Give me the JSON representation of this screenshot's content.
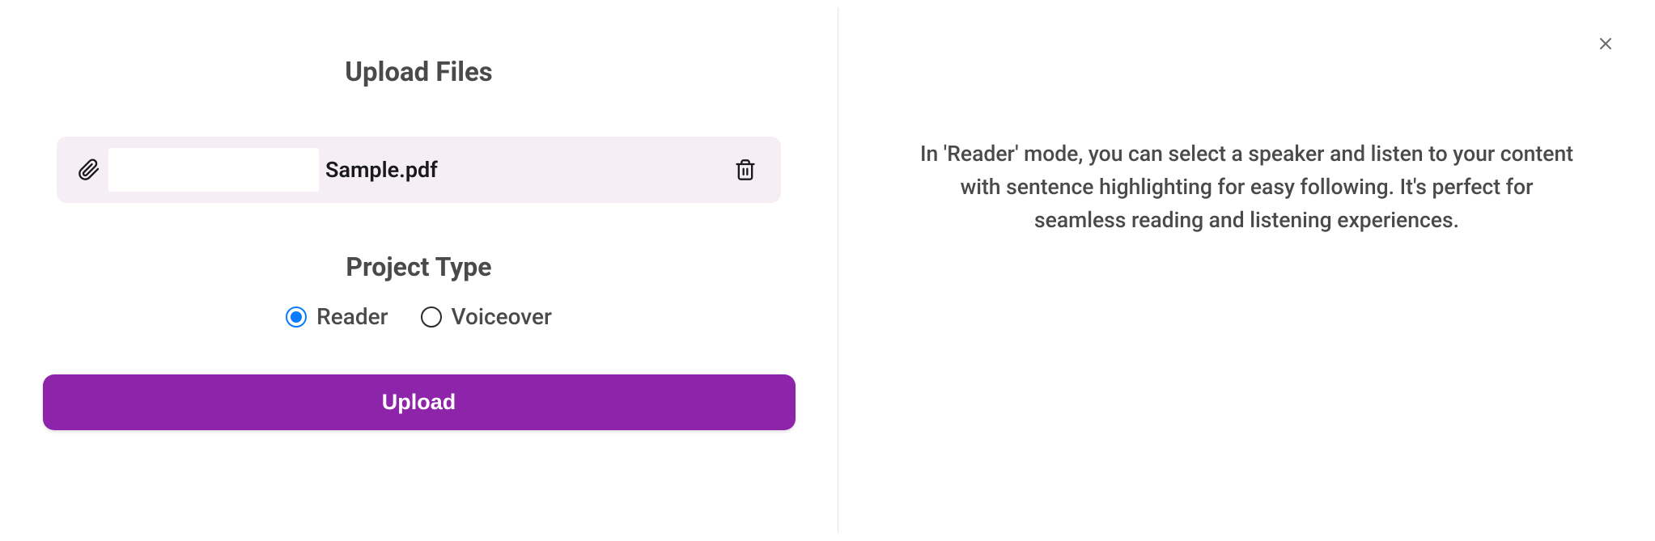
{
  "main": {
    "title": "Upload Files",
    "file": {
      "name": "Sample.pdf"
    },
    "project_type": {
      "label": "Project Type",
      "options": {
        "reader": "Reader",
        "voiceover": "Voiceover"
      },
      "selected": "reader"
    },
    "upload_button": "Upload"
  },
  "side": {
    "description": "In 'Reader' mode, you can select a speaker and listen to your content with sentence highlighting for easy following. It's perfect for seamless reading and listening experiences."
  },
  "colors": {
    "accent": "#8e24aa",
    "radio_selected": "#0a7aff",
    "file_row_bg": "#f6eef5"
  }
}
